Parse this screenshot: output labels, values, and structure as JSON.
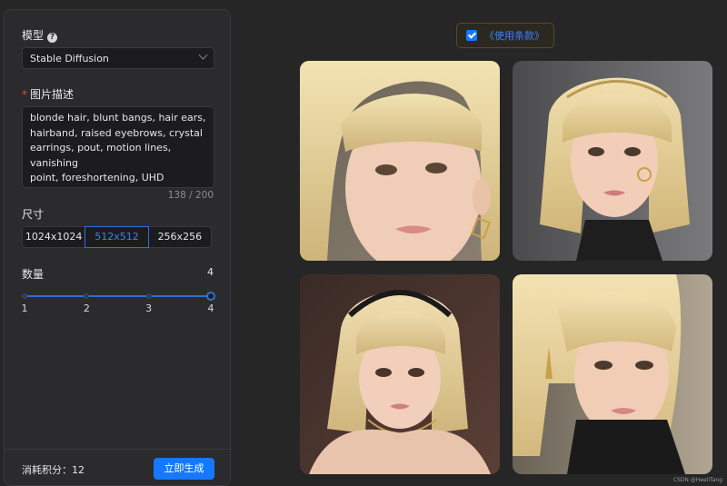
{
  "model": {
    "label": "模型",
    "help": "?",
    "selected": "Stable Diffusion"
  },
  "prompt": {
    "label": "图片描述",
    "required_mark": "*",
    "lines": [
      "blonde hair, blunt bangs, hair ears,",
      "hairband, raised eyebrows, crystal",
      "earrings, pout, motion lines, vanishing",
      "point, foreshortening, UHD"
    ],
    "counter": "138 / 200"
  },
  "size": {
    "label": "尺寸",
    "options": [
      "1024x1024",
      "512x512",
      "256x256"
    ],
    "selected": "512x512"
  },
  "quantity": {
    "label": "数量",
    "value": "4",
    "marks": [
      "1",
      "2",
      "3",
      "4"
    ],
    "min": 1,
    "max": 4,
    "current": 4
  },
  "footer": {
    "cost_label": "消耗积分：12",
    "generate_label": "立即生成"
  },
  "terms": {
    "checked": true,
    "label": "《使用条款》"
  },
  "images": [
    {
      "icon": "generated-portrait-image"
    },
    {
      "icon": "generated-portrait-image"
    },
    {
      "icon": "generated-portrait-image"
    },
    {
      "icon": "generated-portrait-image"
    }
  ],
  "watermark": "CSDN @HeeliTang",
  "colors": {
    "accent": "#1677ff",
    "panel": "#2b2b2d",
    "background": "#262626"
  }
}
